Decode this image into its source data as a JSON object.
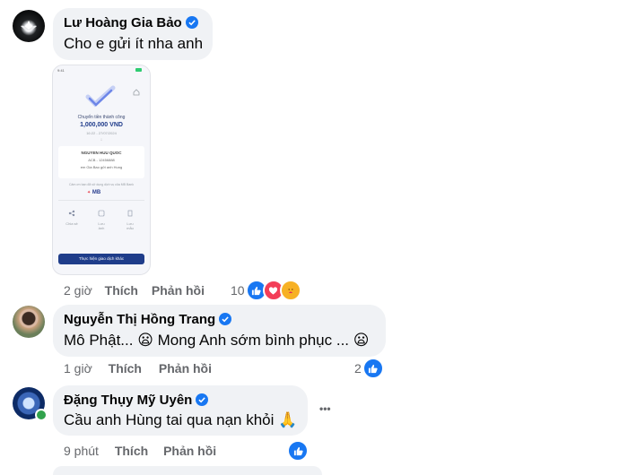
{
  "comments": [
    {
      "author": "Lư Hoàng Gia Bảo",
      "text": "Cho e gửi ít nha anh",
      "time": "2 giờ",
      "like_label": "Thích",
      "reply_label": "Phản hồi",
      "reaction_count": "10",
      "attachment": {
        "title": "Chuyển tiền thành công",
        "amount": "1,000,000 VND",
        "datetime": "16:22 - 27/07/2024",
        "recipient": "NGUYEN HUU QUOC",
        "account": "ACB - 12456888",
        "note": "em Gia Bao gửi anh Hung",
        "thanks": "Cảm ơn bạn đã sử dụng dịch vụ của MB Bank",
        "bank": "MB",
        "actions": [
          "Chia sẻ",
          "Lưu ảnh",
          "Lưu mẫu"
        ],
        "cta": "Thực hiện giao dịch khác"
      }
    },
    {
      "author": "Nguyễn Thị Hồng Trang",
      "text": "Mô Phật... 😦 Mong Anh sớm bình phục ... 😦",
      "time": "1 giờ",
      "like_label": "Thích",
      "reply_label": "Phản hồi",
      "reaction_count": "2"
    },
    {
      "author": "Đặng Thụy Mỹ Uyên",
      "text": "Cầu anh Hùng tai qua nạn khỏi 🙏",
      "time": "9 phút",
      "like_label": "Thích",
      "reply_label": "Phản hồi",
      "more": "•••"
    }
  ],
  "colors": {
    "accent": "#1877f2",
    "bubble": "#f0f2f5",
    "meta_text": "#65676b"
  }
}
